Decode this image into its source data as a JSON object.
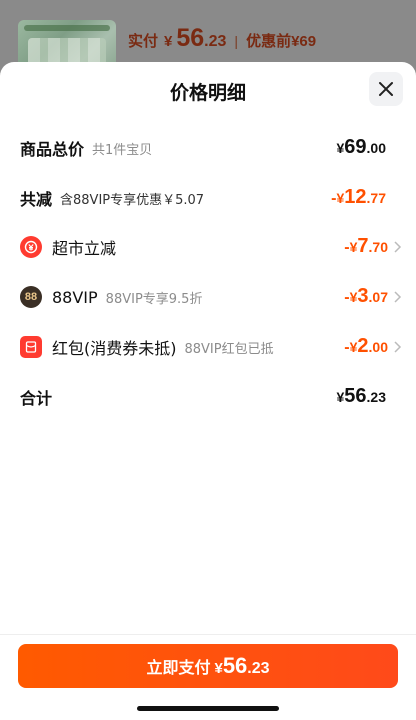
{
  "background": {
    "paid_label": "实付",
    "yen": "¥",
    "paid_int": "56",
    "paid_dec": ".23",
    "separator": "|",
    "pre_discount_label": "优惠前¥69"
  },
  "sheet": {
    "title": "价格明细",
    "close_icon": "close-icon"
  },
  "rows": {
    "goods_total": {
      "label": "商品总价",
      "sub": "共1件宝贝",
      "yen": "¥",
      "int": "69",
      "dec": ".00"
    },
    "total_discount": {
      "label": "共减",
      "sub": "含88VIP专享优惠￥5.07",
      "sign": "-",
      "yen": "¥",
      "int": "12",
      "dec": ".77"
    },
    "supermarket": {
      "label": "超市立减",
      "sign": "-",
      "yen": "¥",
      "int": "7",
      "dec": ".70",
      "icon": "supermarket-discount-icon"
    },
    "vip": {
      "label": "88VIP",
      "sub": "88VIP专享9.5折",
      "sign": "-",
      "yen": "¥",
      "int": "3",
      "dec": ".07",
      "icon": "88vip-badge-icon",
      "icon_text": "88"
    },
    "red_packet": {
      "label": "红包(消费券未抵)",
      "sub": "88VIP红包已抵",
      "sign": "-",
      "yen": "¥",
      "int": "2",
      "dec": ".00",
      "icon": "red-packet-icon"
    },
    "total": {
      "label": "合计",
      "yen": "¥",
      "int": "56",
      "dec": ".23"
    }
  },
  "pay_button": {
    "label": "立即支付",
    "yen": "¥",
    "int": "56",
    "dec": ".23"
  },
  "colors": {
    "accent": "#ff5000",
    "button": "#ff4a1a",
    "icon_red": "#ff3b30",
    "vip_dark": "#3a2f25"
  }
}
